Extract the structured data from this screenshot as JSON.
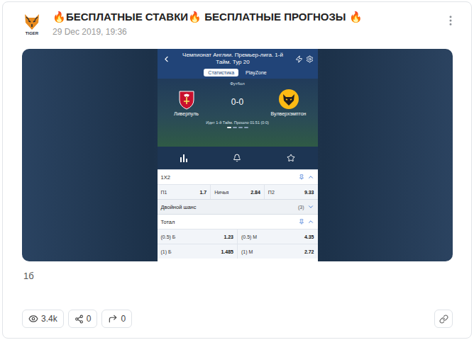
{
  "post": {
    "avatar_label": "TIGER",
    "title": "🔥БЕСПЛАТНЫЕ СТАВКИ🔥 БЕСПЛАТНЫЕ ПРОГНОЗЫ 🔥",
    "date": "29 Dec 2019, 19:36",
    "text": "1б"
  },
  "screenshot": {
    "header": {
      "title": "Чемпионат Англии. Премьер-лига. 1-й Тайм. Тур 20"
    },
    "tabs": [
      {
        "label": "Статистика",
        "selected": true
      },
      {
        "label": "PlayZone",
        "selected": false
      }
    ],
    "match": {
      "sport": "Футбол",
      "home": "Ливерпуль",
      "away": "Вулверхэмптон",
      "score": "0-0",
      "status": "Идет 1-й Тайм. Прошло 01:51 (0:0)"
    },
    "page_dots": [
      {
        "selected": true
      },
      {
        "selected": false
      },
      {
        "selected": false
      },
      {
        "selected": false
      }
    ],
    "markets": [
      {
        "title": "1X2",
        "count": "",
        "pinned": true,
        "expanded": true,
        "rows": [
          [
            {
              "label": "П1",
              "odds": "1.7"
            },
            {
              "label": "Ничья",
              "odds": "2.84"
            },
            {
              "label": "П2",
              "odds": "9.33"
            }
          ]
        ]
      },
      {
        "title": "Двойной шанс",
        "count": "(3)",
        "pinned": false,
        "expanded": false,
        "rows": []
      },
      {
        "title": "Тотал",
        "count": "",
        "pinned": true,
        "expanded": true,
        "rows": [
          [
            {
              "label": "(0.5) Б",
              "odds": "1.23"
            },
            {
              "label": "(0.5) М",
              "odds": "4.35"
            }
          ],
          [
            {
              "label": "(1) Б",
              "odds": "1.485"
            },
            {
              "label": "(1) М",
              "odds": "2.72"
            }
          ]
        ]
      }
    ]
  },
  "stats": [
    {
      "kind": "views",
      "value": "3.4k"
    },
    {
      "kind": "shares",
      "value": "0"
    },
    {
      "kind": "reposts",
      "value": "0"
    }
  ]
}
